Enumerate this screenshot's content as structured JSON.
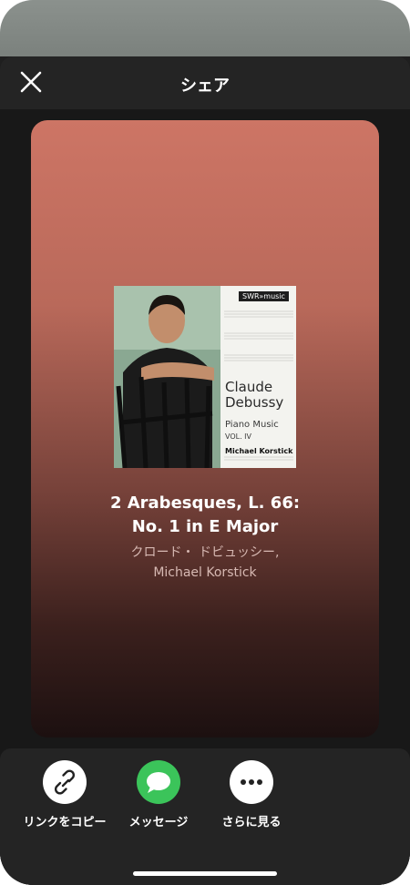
{
  "header": {
    "title": "シェア",
    "close_icon": "close-icon"
  },
  "album": {
    "label": "SWR»music",
    "composer_first": "Claude",
    "composer_last": "Debussy",
    "subtitle": "Piano Music",
    "volume": "VOL. IV",
    "performer": "Michael Korstick"
  },
  "track": {
    "title_line1": "2 Arabesques, L. 66:",
    "title_line2": "No. 1 in E Major",
    "artist_line1": "クロード・ ドビュッシー,",
    "artist_line2": "Michael Korstick"
  },
  "share_options": [
    {
      "label": "リンクをコピー",
      "icon": "link-icon",
      "color": "#ffffff"
    },
    {
      "label": "メッセージ",
      "icon": "message-bubble-icon",
      "color": "#3bc45a"
    },
    {
      "label": "さらに見る",
      "icon": "more-dots-icon",
      "color": "#ffffff"
    }
  ],
  "colors": {
    "card_top": "#cd7565",
    "card_bottom": "#1c1010",
    "sheet": "#242424"
  }
}
